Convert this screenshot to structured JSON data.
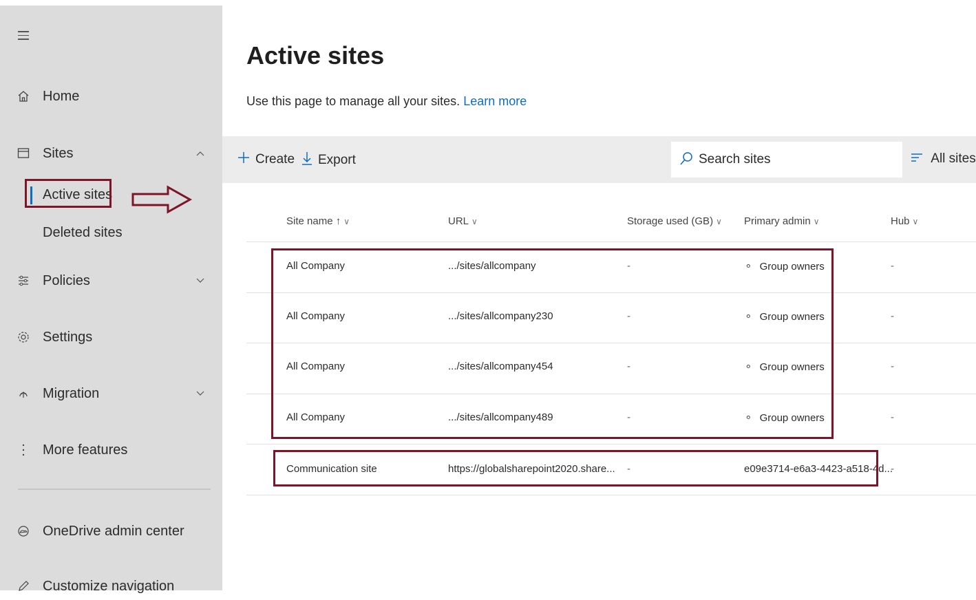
{
  "sidebar": {
    "items": [
      {
        "label": "Home",
        "icon": "home-icon"
      },
      {
        "label": "Sites",
        "icon": "sites-icon"
      },
      {
        "label": "Policies",
        "icon": "policies-icon"
      },
      {
        "label": "Settings",
        "icon": "gear-icon"
      },
      {
        "label": "Migration",
        "icon": "migration-icon"
      },
      {
        "label": "More features",
        "icon": "more-icon"
      },
      {
        "label": "OneDrive admin center",
        "icon": "onedrive-icon"
      },
      {
        "label": "Customize navigation",
        "icon": "pencil-icon"
      }
    ],
    "sub_items": [
      {
        "label": "Active sites",
        "selected": true
      },
      {
        "label": "Deleted sites"
      }
    ]
  },
  "page": {
    "title": "Active sites",
    "subtitle": "Use this page to manage all your sites.",
    "learn_more": "Learn more"
  },
  "toolbar": {
    "create_label": "Create",
    "export_label": "Export",
    "search_placeholder": "Search sites",
    "filter_label": "All sites"
  },
  "table": {
    "columns": [
      "Site name ↑",
      "URL",
      "Storage used (GB)",
      "Primary admin",
      "Hub"
    ],
    "rows": [
      {
        "name": "All Company",
        "url": ".../sites/allcompany",
        "storage": "-",
        "admin": "Group owners",
        "hub": "-"
      },
      {
        "name": "All Company",
        "url": ".../sites/allcompany230",
        "storage": "-",
        "admin": "Group owners",
        "hub": "-"
      },
      {
        "name": "All Company",
        "url": ".../sites/allcompany454",
        "storage": "-",
        "admin": "Group owners",
        "hub": "-"
      },
      {
        "name": "All Company",
        "url": ".../sites/allcompany489",
        "storage": "-",
        "admin": "Group owners",
        "hub": "-"
      },
      {
        "name": "Communication site",
        "url": "https://globalsharepoint2020.share...",
        "storage": "-",
        "admin": "e09e3714-e6a3-4423-a518-4d...",
        "hub": "-"
      }
    ]
  },
  "colors": {
    "accent": "#0f6cbd",
    "highlight": "#7b1527",
    "sidebar_bg": "#dcdcdc"
  }
}
